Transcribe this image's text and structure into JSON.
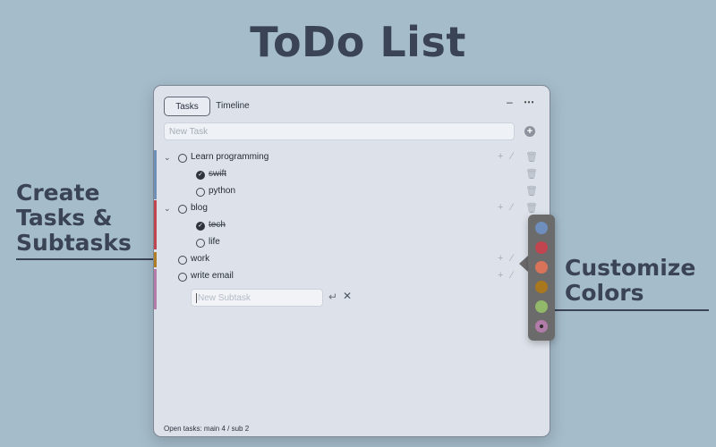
{
  "hero": {
    "title": "ToDo List",
    "left_callout": [
      "Create",
      "Tasks &",
      "Subtasks"
    ],
    "right_callout": [
      "Customize",
      "Colors"
    ]
  },
  "window": {
    "tabs": [
      {
        "label": "Tasks",
        "active": true
      },
      {
        "label": "Timeline",
        "active": false
      }
    ],
    "controls": {
      "minimize": "–",
      "more": "⋯"
    },
    "new_task_placeholder": "New Task",
    "tasks": [
      {
        "label": "Learn programming",
        "color": "#6f8fb7",
        "done": false,
        "expanded": true,
        "subtasks": [
          {
            "label": "swift",
            "done": true
          },
          {
            "label": "python",
            "done": false
          }
        ]
      },
      {
        "label": "blog",
        "color": "#c0454f",
        "done": false,
        "expanded": true,
        "subtasks": [
          {
            "label": "tech",
            "done": true
          },
          {
            "label": "life",
            "done": false
          }
        ]
      },
      {
        "label": "work",
        "color": "#b07f24",
        "done": false,
        "expanded": false,
        "subtasks": []
      },
      {
        "label": "write email",
        "color": "#b27ca9",
        "done": false,
        "expanded": false,
        "subtasks": []
      }
    ],
    "new_subtask_placeholder": "New Subtask",
    "status": {
      "text": "Open tasks: main 4  /  sub 2"
    }
  },
  "palette": {
    "colors": [
      "#6e8ebd",
      "#c0454f",
      "#d9735a",
      "#a9771d",
      "#92b86a",
      "#b27ca9"
    ],
    "selected_index": 5
  }
}
